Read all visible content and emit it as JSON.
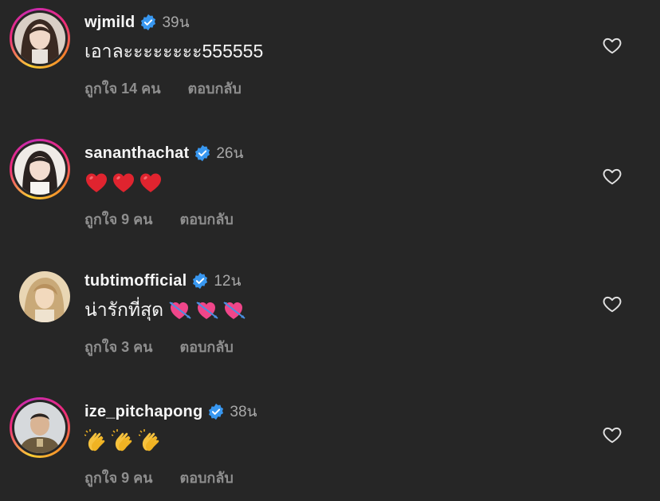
{
  "comments": [
    {
      "username": "wjmild",
      "time": "39น",
      "text": "เอาละะะะะะะะ555555",
      "likes": "ถูกใจ 14 คน",
      "reply": "ตอบกลับ",
      "emoji": []
    },
    {
      "username": "sananthachat",
      "time": "26น",
      "text": "",
      "likes": "ถูกใจ 9 คน",
      "reply": "ตอบกลับ",
      "emoji": [
        "red-heart-icon",
        "red-heart-icon",
        "red-heart-icon"
      ]
    },
    {
      "username": "tubtimofficial",
      "time": "12น",
      "text": "น่ารักที่สุด",
      "likes": "ถูกใจ 3 คน",
      "reply": "ตอบกลับ",
      "emoji": [
        "heart-with-arrow-icon",
        "heart-with-arrow-icon",
        "heart-with-arrow-icon"
      ]
    },
    {
      "username": "ize_pitchapong",
      "time": "38น",
      "text": "",
      "likes": "ถูกใจ 9 คน",
      "reply": "ตอบกลับ",
      "emoji": [
        "clapping-hands-icon",
        "clapping-hands-icon",
        "clapping-hands-icon"
      ]
    }
  ],
  "colors": {
    "background": "#262626",
    "text_primary": "#f5f5f5",
    "text_secondary": "#a8a8a8",
    "meta_text": "#8e8e8e",
    "verified_badge": "#3897f0"
  }
}
